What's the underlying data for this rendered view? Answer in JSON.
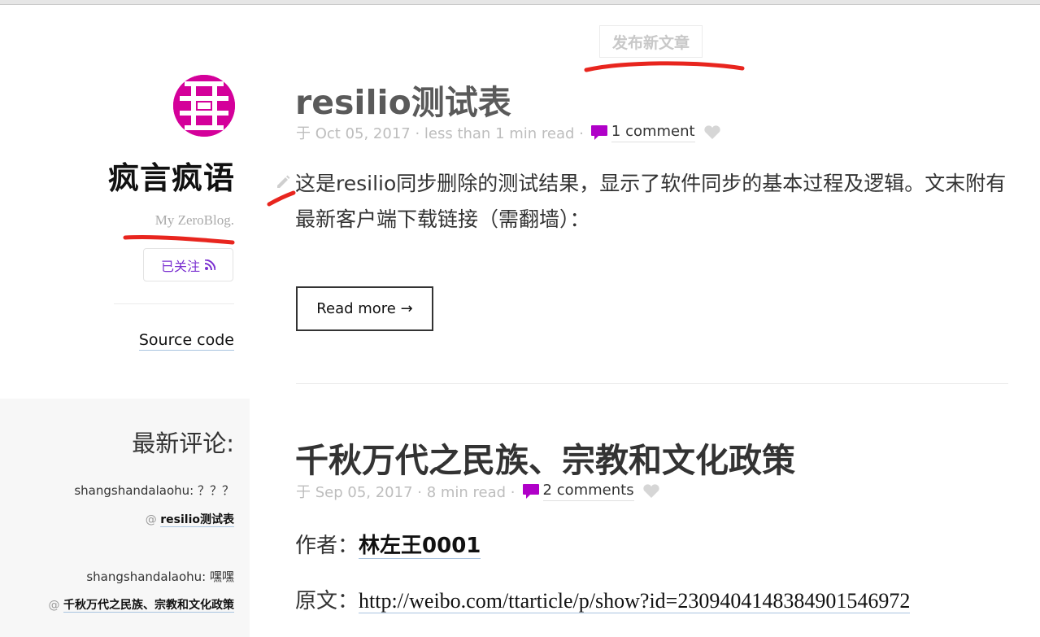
{
  "sidebar": {
    "blog_title": "疯言疯语",
    "blog_subtitle": "My ZeroBlog.",
    "follow_label": "已关注",
    "source_code_label": "Source code",
    "comments_heading": "最新评论:",
    "comments": [
      {
        "author_text": "shangshandalaohu: ？？？",
        "at": "@",
        "target": "resilio测试表"
      },
      {
        "author_text": "shangshandalaohu: 嘿嘿",
        "at": "@",
        "target": "千秋万代之民族、宗教和文化政策"
      }
    ]
  },
  "header": {
    "new_post_label": "发布新文章"
  },
  "posts": [
    {
      "title": "resilio测试表",
      "meta_text": "于 Oct 05, 2017 · less than 1 min read ·",
      "comments_label": "1 comment",
      "body": "这是resilio同步删除的测试结果，显示了软件同步的基本过程及逻辑。文末附有最新客户端下载链接（需翻墙）：",
      "read_more_label": "Read more →"
    },
    {
      "title": "千秋万代之民族、宗教和文化政策",
      "meta_text": "于 Sep 05, 2017 · 8 min read ·",
      "comments_label": "2 comments",
      "author_label": "作者：",
      "author_name": "林左王0001",
      "source_label": "原文：",
      "source_url": "http://weibo.com/ttarticle/p/show?id=2309404148384901546972"
    }
  ],
  "colors": {
    "accent_purple": "#7a2fd0",
    "comment_icon": "#b000c8",
    "avatar_bg": "#d4009a",
    "annotation_red": "#e8251e"
  }
}
